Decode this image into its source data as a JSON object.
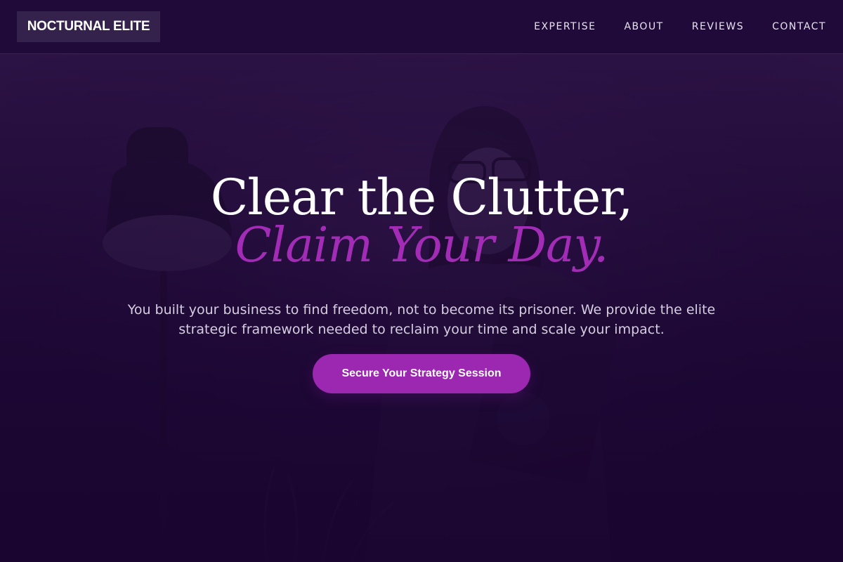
{
  "header": {
    "logo": "NOCTURNAL ELITE",
    "nav": [
      {
        "label": "EXPERTISE"
      },
      {
        "label": "ABOUT"
      },
      {
        "label": "REVIEWS"
      },
      {
        "label": "CONTACT"
      }
    ]
  },
  "hero": {
    "title_line1": "Clear the Clutter,",
    "title_line2": "Claim Your Day.",
    "subtitle": "You built your business to find freedom, not to become its prisoner. We provide the elite strategic framework needed to reclaim your time and scale your impact.",
    "cta_label": "Secure Your Strategy Session"
  },
  "colors": {
    "background": "#1e0836",
    "header": "#200a39",
    "accent": "#9c27b0",
    "accent_text": "#a32cb6",
    "text": "#ffffff"
  }
}
